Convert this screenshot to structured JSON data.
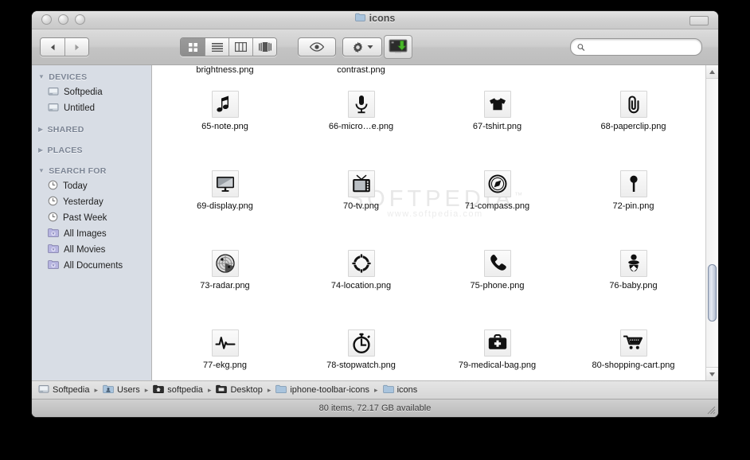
{
  "window": {
    "title": "icons",
    "title_icon": "folder-icon",
    "traffic_lights": [
      "close-button",
      "minimize-button",
      "zoom-button"
    ]
  },
  "toolbar": {
    "back_label": "◀",
    "forward_label": "▶",
    "view_modes": [
      {
        "name": "icon-view",
        "active": true
      },
      {
        "name": "list-view",
        "active": false
      },
      {
        "name": "column-view",
        "active": false
      },
      {
        "name": "coverflow-view",
        "active": false
      }
    ],
    "quicklook_label": "eye-icon",
    "action_label": "gear-icon",
    "download_label": "download-icon",
    "search": {
      "value": "",
      "placeholder": "",
      "icon": "search-icon"
    }
  },
  "sidebar": {
    "sections": [
      {
        "label": "DEVICES",
        "expanded": true,
        "items": [
          {
            "label": "Softpedia",
            "icon": "hard-drive-icon"
          },
          {
            "label": "Untitled",
            "icon": "hard-drive-icon"
          }
        ]
      },
      {
        "label": "SHARED",
        "expanded": false,
        "items": []
      },
      {
        "label": "PLACES",
        "expanded": false,
        "items": []
      },
      {
        "label": "SEARCH FOR",
        "expanded": true,
        "items": [
          {
            "label": "Today",
            "icon": "clock-icon"
          },
          {
            "label": "Yesterday",
            "icon": "clock-icon"
          },
          {
            "label": "Past Week",
            "icon": "clock-icon"
          },
          {
            "label": "All Images",
            "icon": "smart-folder-icon"
          },
          {
            "label": "All Movies",
            "icon": "smart-folder-icon"
          },
          {
            "label": "All Documents",
            "icon": "smart-folder-icon"
          }
        ]
      }
    ]
  },
  "files": {
    "clipped_row": [
      {
        "name": "brightness.png"
      },
      {
        "name": "contrast.png"
      },
      {
        "name": ""
      },
      {
        "name": ""
      }
    ],
    "items": [
      {
        "name": "65-note.png",
        "icon": "music-note-icon"
      },
      {
        "name": "66-micro…e.png",
        "icon": "microphone-icon"
      },
      {
        "name": "67-tshirt.png",
        "icon": "tshirt-icon"
      },
      {
        "name": "68-paperclip.png",
        "icon": "paperclip-icon"
      },
      {
        "name": "69-display.png",
        "icon": "display-icon"
      },
      {
        "name": "70-tv.png",
        "icon": "tv-icon"
      },
      {
        "name": "71-compass.png",
        "icon": "compass-icon"
      },
      {
        "name": "72-pin.png",
        "icon": "pin-icon"
      },
      {
        "name": "73-radar.png",
        "icon": "radar-icon"
      },
      {
        "name": "74-location.png",
        "icon": "location-icon"
      },
      {
        "name": "75-phone.png",
        "icon": "phone-icon"
      },
      {
        "name": "76-baby.png",
        "icon": "baby-icon"
      },
      {
        "name": "77-ekg.png",
        "icon": "ekg-icon"
      },
      {
        "name": "78-stopwatch.png",
        "icon": "stopwatch-icon"
      },
      {
        "name": "79-medical-bag.png",
        "icon": "medical-bag-icon"
      },
      {
        "name": "80-shopping-cart.png",
        "icon": "shopping-cart-icon"
      }
    ]
  },
  "watermark": {
    "brand": "SOFTPEDIA",
    "tm": "™",
    "url": "www.softpedia.com"
  },
  "pathbar": {
    "crumbs": [
      {
        "label": "Softpedia",
        "icon": "hard-drive-icon"
      },
      {
        "label": "Users",
        "icon": "users-folder-icon"
      },
      {
        "label": "softpedia",
        "icon": "home-folder-icon"
      },
      {
        "label": "Desktop",
        "icon": "desktop-folder-icon"
      },
      {
        "label": "iphone-toolbar-icons",
        "icon": "folder-icon"
      },
      {
        "label": "icons",
        "icon": "folder-icon"
      }
    ],
    "separator": "▸"
  },
  "statusbar": {
    "text": "80 items, 72.17 GB available"
  }
}
